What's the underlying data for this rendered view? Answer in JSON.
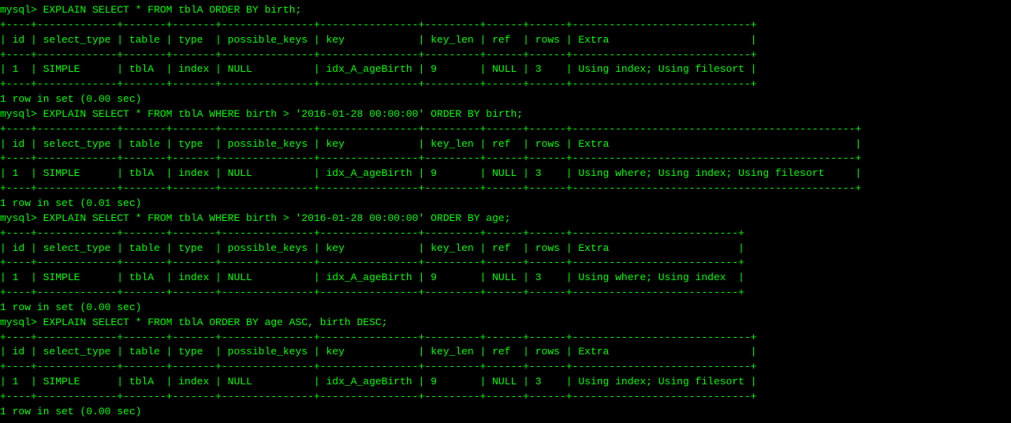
{
  "terminal": {
    "lines": [
      "mysql> EXPLAIN SELECT * FROM tblA ORDER BY birth;",
      "+----+-------------+-------+-------+---------------+----------------+---------+------+------+-----------------------------+",
      "| id | select_type | table | type  | possible_keys | key            | key_len | ref  | rows | Extra                       |",
      "+----+-------------+-------+-------+---------------+----------------+---------+------+------+-----------------------------+",
      "| 1  | SIMPLE      | tblA  | index | NULL          | idx_A_ageBirth | 9       | NULL | 3    | Using index; Using filesort |",
      "+----+-------------+-------+-------+---------------+----------------+---------+------+------+-----------------------------+",
      "1 row in set (0.00 sec)",
      "",
      "mysql> EXPLAIN SELECT * FROM tblA WHERE birth > '2016-01-28 00:00:00' ORDER BY birth;",
      "+----+-------------+-------+-------+---------------+----------------+---------+------+------+----------------------------------------------+",
      "| id | select_type | table | type  | possible_keys | key            | key_len | ref  | rows | Extra                                        |",
      "+----+-------------+-------+-------+---------------+----------------+---------+------+------+----------------------------------------------+",
      "| 1  | SIMPLE      | tblA  | index | NULL          | idx_A_ageBirth | 9       | NULL | 3    | Using where; Using index; Using filesort     |",
      "+----+-------------+-------+-------+---------------+----------------+---------+------+------+----------------------------------------------+",
      "1 row in set (0.01 sec)",
      "",
      "mysql> EXPLAIN SELECT * FROM tblA WHERE birth > '2016-01-28 00:00:00' ORDER BY age;",
      "+----+-------------+-------+-------+---------------+----------------+---------+------+------+---------------------------+",
      "| id | select_type | table | type  | possible_keys | key            | key_len | ref  | rows | Extra                     |",
      "+----+-------------+-------+-------+---------------+----------------+---------+------+------+---------------------------+",
      "| 1  | SIMPLE      | tblA  | index | NULL          | idx_A_ageBirth | 9       | NULL | 3    | Using where; Using index  |",
      "+----+-------------+-------+-------+---------------+----------------+---------+------+------+---------------------------+",
      "1 row in set (0.00 sec)",
      "",
      "mysql> EXPLAIN SELECT * FROM tblA ORDER BY age ASC, birth DESC;",
      "+----+-------------+-------+-------+---------------+----------------+---------+------+------+-----------------------------+",
      "| id | select_type | table | type  | possible_keys | key            | key_len | ref  | rows | Extra                       |",
      "+----+-------------+-------+-------+---------------+----------------+---------+------+------+-----------------------------+",
      "| 1  | SIMPLE      | tblA  | index | NULL          | idx_A_ageBirth | 9       | NULL | 3    | Using index; Using filesort |",
      "+----+-------------+-------+-------+---------------+----------------+---------+------+------+-----------------------------+",
      "1 row in set (0.00 sec)"
    ]
  }
}
